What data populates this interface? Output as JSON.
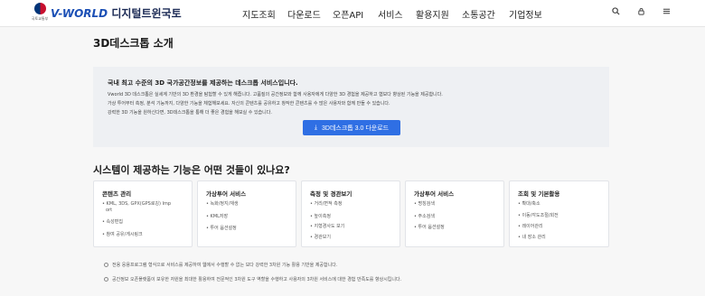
{
  "header": {
    "emblem_text": "국토교통부",
    "logo_prefix": "V-WORLD",
    "logo_suffix": "디지털트윈국토",
    "menu": [
      "지도조회",
      "다운로드",
      "오픈API",
      "서비스",
      "활용지원",
      "소통공간",
      "기업정보"
    ],
    "icons": [
      "search-icon",
      "lock-icon",
      "menu-icon"
    ]
  },
  "page": {
    "title": "3D데스크톱 소개"
  },
  "intro": {
    "heading": "국내 최고 수준의 3D 국가공간정보를 제공하는 데스크톱 서비스입니다.",
    "lines": [
      "Vworld 3D 데스크톱은 실세계 기반의 3D 환경을 탐험할 수 있게 해줍니다. 고품질의 공간정보와 함께 사용자에게 다양한 3D 경험을 제공하고 협보다 향상된 기능을 제공합니다.",
      "가상 투어부터 측정, 분석 기능까지, 다양한 기능을 체험해보세요. 자신의 콘텐츠를 공유하고 창작한 콘텐츠를 수 많은 사용자와 함께 만들 수 있습니다.",
      "강력한 3D 기능을 원하신다면, 3D데스크톱을 통해 더 좋은 경험을 해보실 수 있습니다."
    ],
    "download_label": "3D데스크톱 3.0 다운로드"
  },
  "features": {
    "title": "시스템이 제공하는 기능은 어떤 것들이 있나요?",
    "cards": [
      {
        "title": "콘텐츠 관리",
        "items": [
          "KML, 3DS, GPX(GPS로깅) Imp",
          "ort",
          "속성편집",
          "참여 공유/게시링크"
        ]
      },
      {
        "title": "가상투어 서비스",
        "items": [
          "녹화/정지/재생",
          "KML저장",
          "투어 옵션설정"
        ]
      },
      {
        "title": "측정 및 경관보기",
        "items": [
          "거리/면적 측정",
          "높이측정",
          "지형경사도 보기",
          "경관보기"
        ]
      },
      {
        "title": "가상투어 서비스",
        "items": [
          "명칭검색",
          "주소검색",
          "투어 옵션설정"
        ]
      },
      {
        "title": "조회 및 기본활용",
        "items": [
          "확대/축소",
          "이동/각도조절/회전",
          "레이어관리",
          "내 장소 관리"
        ]
      }
    ]
  },
  "notes": [
    "전용 응용프로그램 형식으로 서비스를 제공하여 웹에서 수행할 수 없는 보다 강력한 3차원 기능 활용 기반을 제공합니다.",
    "공간정보 오픈플랫폼이 보유한 자원을 최대한 활용하여 전문적인 3차원 도구 역할을 수행하고 사용자의 3차원 서비스에 대한 경험 만족도를 향상시킵니다."
  ]
}
